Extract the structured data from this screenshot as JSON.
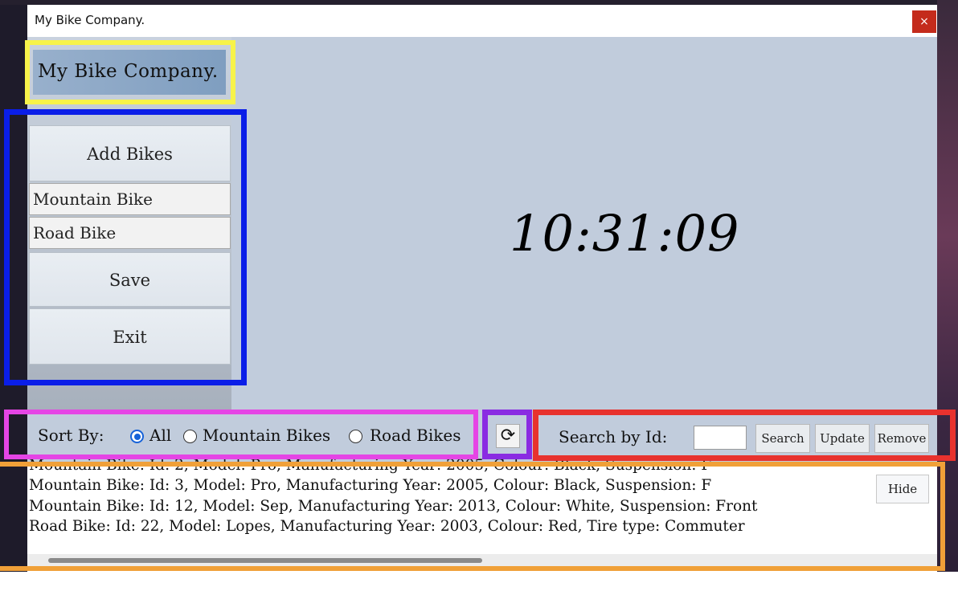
{
  "window": {
    "title": "My Bike Company.",
    "close_glyph": "×"
  },
  "sidebar": {
    "logo_text": "My Bike Company.",
    "add_bikes": "Add Bikes",
    "mountain_bike": "Mountain Bike",
    "road_bike": "Road Bike",
    "save": "Save",
    "exit": "Exit"
  },
  "clock": {
    "time": "10:31:09"
  },
  "sort": {
    "label": "Sort By:",
    "options": [
      "All",
      "Mountain Bikes",
      "Road Bikes"
    ],
    "selected": "All"
  },
  "refresh": {
    "icon": "refresh-icon",
    "glyph": "⟳"
  },
  "search": {
    "label": "Search by Id:",
    "value": "",
    "search_button": "Search",
    "update_button": "Update",
    "remove_button": "Remove"
  },
  "output": {
    "lines": [
      "Mountain Bike: Id: 2, Model: Pro, Manufacturing Year: 2005, Colour: Black, Suspension: F",
      "Mountain Bike: Id: 3, Model: Pro, Manufacturing Year: 2005, Colour: Black, Suspension: F",
      "Mountain Bike: Id: 12, Model: Sep, Manufacturing Year: 2013, Colour: White, Suspension: Front",
      "Road Bike: Id: 22, Model: Lopes, Manufacturing Year: 2003, Colour: Red, Tire type: Commuter"
    ],
    "hide_button": "Hide"
  },
  "annotation_colors": {
    "logo": "#f7f34a",
    "nav": "#0a1ee8",
    "sort": "#e545e5",
    "refresh": "#8a2be2",
    "search": "#e8322e",
    "output": "#f0a038"
  }
}
